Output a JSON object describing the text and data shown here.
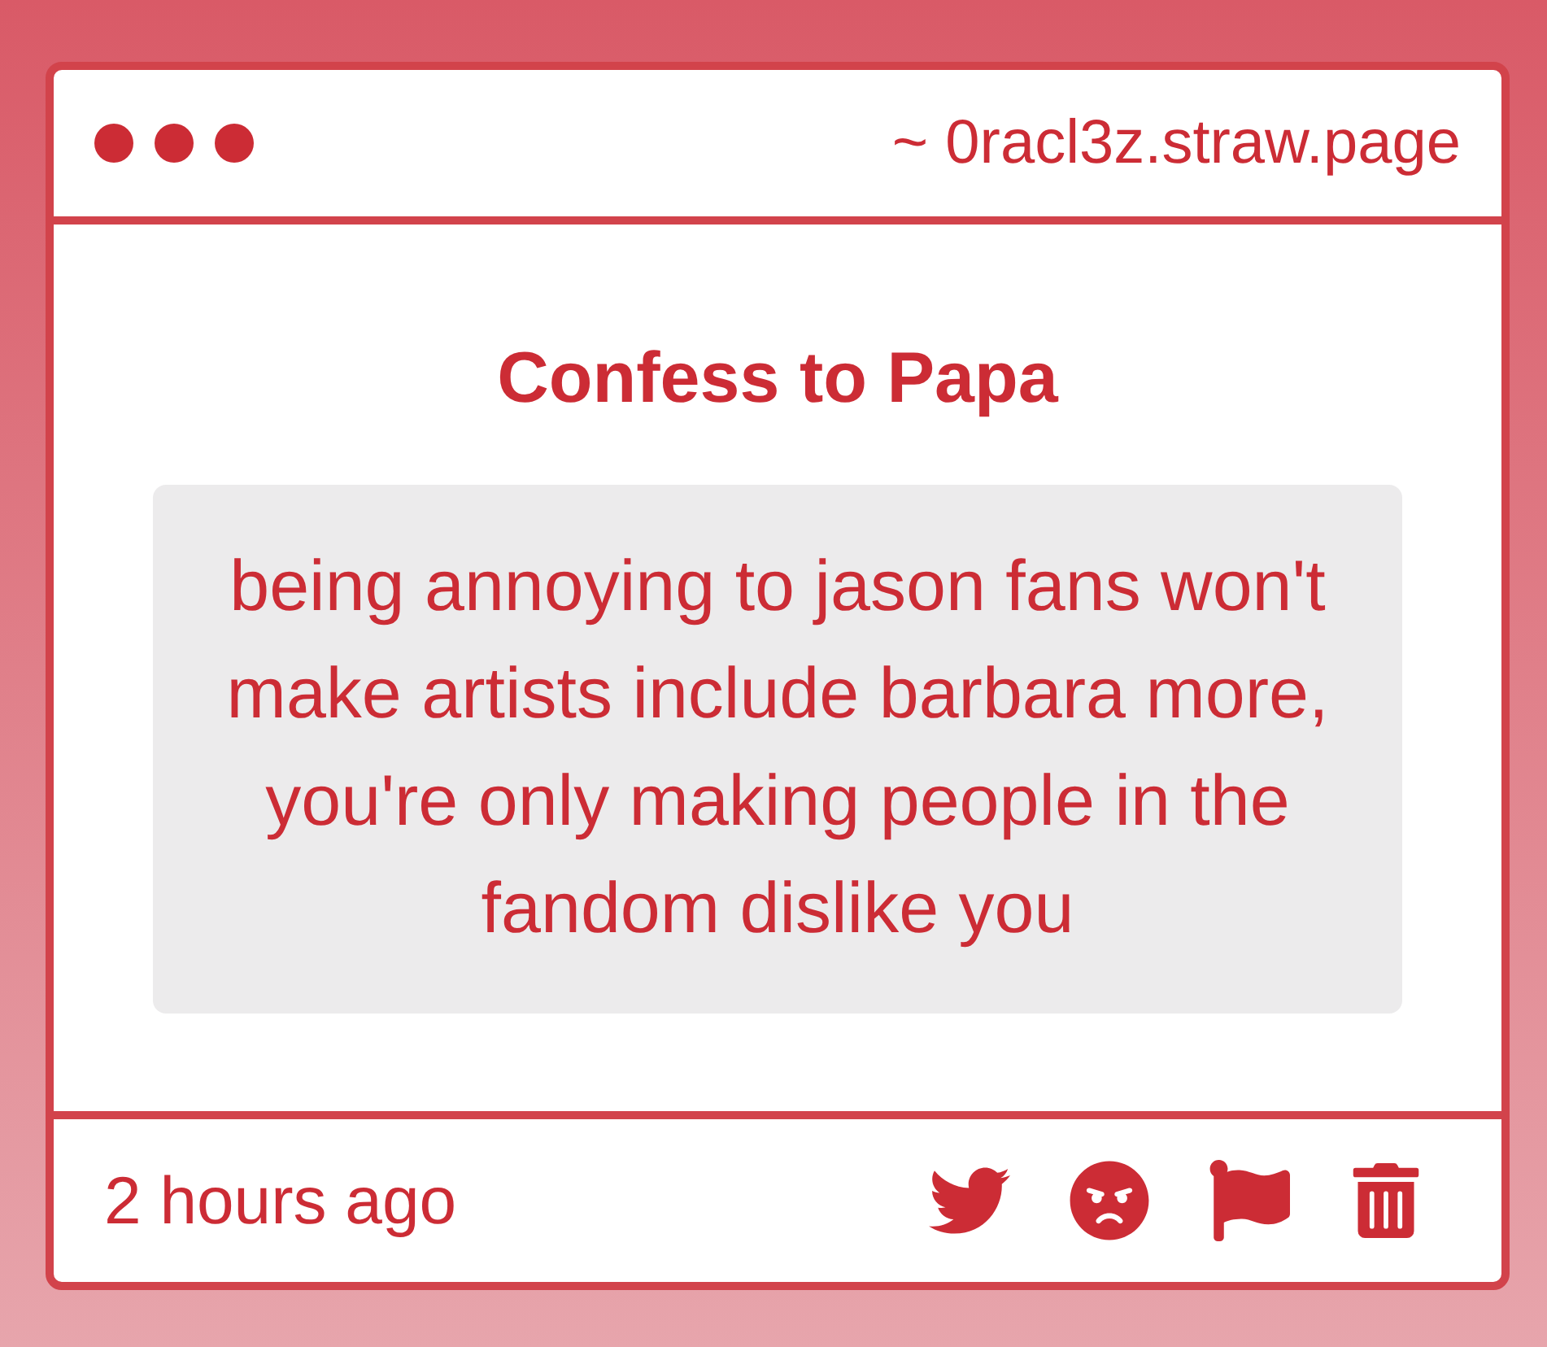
{
  "window": {
    "url": "~ 0racl3z.straw.page"
  },
  "card": {
    "title": "Confess to Papa",
    "message": "being annoying to jason fans won't make artists include barbara more, you're only making people in the fandom dislike you"
  },
  "footer": {
    "time": "2 hours ago",
    "actions": [
      {
        "kind": "twitter"
      },
      {
        "kind": "angry"
      },
      {
        "kind": "flag"
      },
      {
        "kind": "delete"
      }
    ]
  }
}
